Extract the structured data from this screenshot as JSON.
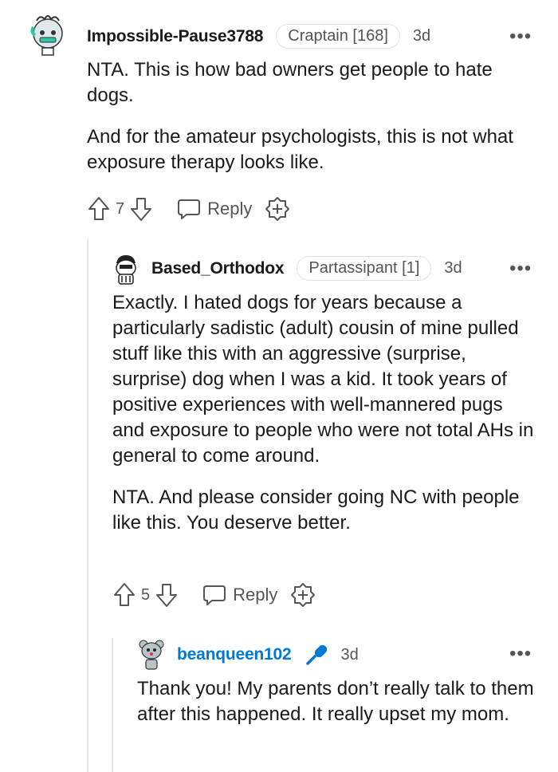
{
  "comments": [
    {
      "username": "Impossible-Pause3788",
      "flair": "Craptain [168]",
      "time": "3d",
      "more": "•••",
      "paragraphs": [
        "NTA. This is how bad owners get people to hate dogs.",
        "And for the amateur psychologists, this is not what exposure therapy looks like."
      ],
      "score": "7",
      "reply_label": "Reply",
      "icons": {
        "upvote": "arrow-up-icon",
        "downvote": "arrow-down-icon",
        "reply": "speech-bubble-icon",
        "award": "award-plus-icon"
      }
    },
    {
      "username": "Based_Orthodox",
      "flair": "Partassipant [1]",
      "time": "3d",
      "more": "•••",
      "paragraphs": [
        "Exactly. I hated dogs for years because a particularly sadistic (adult) cousin of mine pulled stuff like this with an aggressive (surprise, surprise) dog when I was a kid. It took years of positive experiences with well-mannered pugs and exposure to people who were not total AHs in general to come around.",
        "NTA. And please consider going NC with people like this. You deserve better."
      ],
      "score": "5",
      "reply_label": "Reply"
    },
    {
      "username": "beanqueen102",
      "time": "3d",
      "more": "•••",
      "op_badge": "microphone-icon",
      "paragraphs": [
        "Thank you! My parents don’t really talk to them after this happened. It really upset my mom."
      ]
    }
  ],
  "colors": {
    "op_blue": "#0079d3",
    "thread_line": "#e4e6e8",
    "meta_gray": "#555555"
  }
}
